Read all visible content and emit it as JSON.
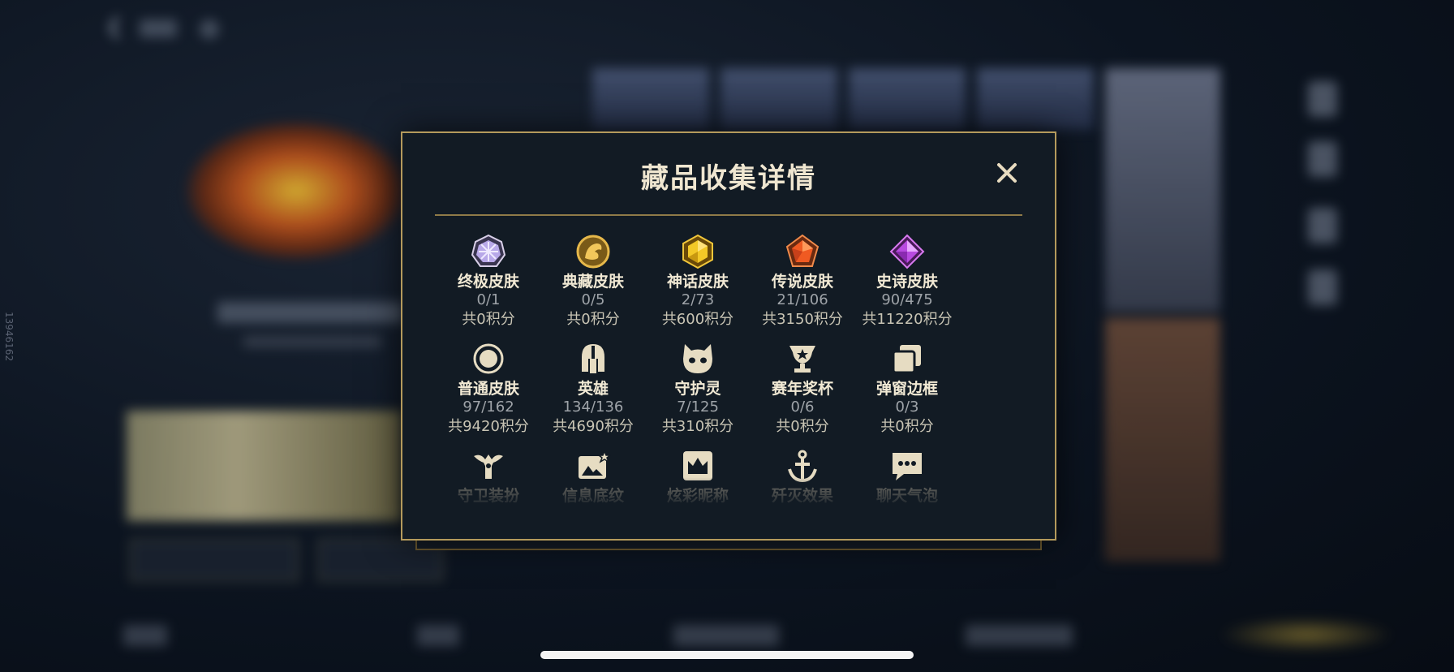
{
  "background": {
    "side_id": "13946162"
  },
  "modal": {
    "title": "藏品收集详情",
    "close_icon": "close-icon",
    "accent_color": "#b49a5c",
    "rows": [
      [
        {
          "name": "终极皮肤",
          "count": "0/1",
          "points": "共0积分",
          "icon": "ultimate-skin-icon"
        },
        {
          "name": "典藏皮肤",
          "count": "0/5",
          "points": "共0积分",
          "icon": "prestige-skin-icon"
        },
        {
          "name": "神话皮肤",
          "count": "2/73",
          "points": "共600积分",
          "icon": "mythic-skin-icon"
        },
        {
          "name": "传说皮肤",
          "count": "21/106",
          "points": "共3150积分",
          "icon": "legendary-skin-icon"
        },
        {
          "name": "史诗皮肤",
          "count": "90/475",
          "points": "共11220积分",
          "icon": "epic-skin-icon"
        }
      ],
      [
        {
          "name": "普通皮肤",
          "count": "97/162",
          "points": "共9420积分",
          "icon": "standard-skin-icon"
        },
        {
          "name": "英雄",
          "count": "134/136",
          "points": "共4690积分",
          "icon": "champion-helmet-icon"
        },
        {
          "name": "守护灵",
          "count": "7/125",
          "points": "共310积分",
          "icon": "guardian-spirit-icon"
        },
        {
          "name": "赛年奖杯",
          "count": "0/6",
          "points": "共0积分",
          "icon": "season-trophy-icon"
        },
        {
          "name": "弹窗边框",
          "count": "0/3",
          "points": "共0积分",
          "icon": "popup-frame-icon"
        }
      ],
      [
        {
          "name": "守卫装扮",
          "icon": "ward-skin-icon"
        },
        {
          "name": "信息底纹",
          "icon": "profile-banner-icon"
        },
        {
          "name": "炫彩昵称",
          "icon": "chroma-name-icon"
        },
        {
          "name": "歼灭效果",
          "icon": "ace-effect-icon"
        },
        {
          "name": "聊天气泡",
          "icon": "chat-bubble-icon"
        }
      ]
    ]
  }
}
